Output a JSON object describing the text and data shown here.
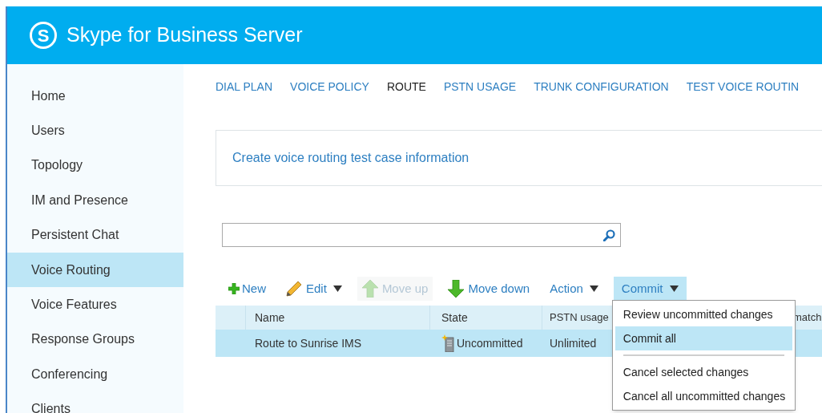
{
  "header": {
    "logo_glyph": "S",
    "title": "Skype for Business Server"
  },
  "sidebar": {
    "items": [
      {
        "label": "Home",
        "selected": false
      },
      {
        "label": "Users",
        "selected": false
      },
      {
        "label": "Topology",
        "selected": false
      },
      {
        "label": "IM and Presence",
        "selected": false
      },
      {
        "label": "Persistent Chat",
        "selected": false
      },
      {
        "label": "Voice Routing",
        "selected": true
      },
      {
        "label": "Voice Features",
        "selected": false
      },
      {
        "label": "Response Groups",
        "selected": false
      },
      {
        "label": "Conferencing",
        "selected": false
      },
      {
        "label": "Clients",
        "selected": false
      }
    ]
  },
  "tabs": [
    {
      "label": "DIAL PLAN",
      "selected": false
    },
    {
      "label": "VOICE POLICY",
      "selected": false
    },
    {
      "label": "ROUTE",
      "selected": true
    },
    {
      "label": "PSTN USAGE",
      "selected": false
    },
    {
      "label": "TRUNK CONFIGURATION",
      "selected": false
    },
    {
      "label": "TEST VOICE ROUTIN",
      "selected": false
    }
  ],
  "info_link": "Create voice routing test case information",
  "toolbar": [
    {
      "label": "New",
      "kind": "plus",
      "dropdown": false,
      "disabled": false,
      "expanded": false
    },
    {
      "label": "Edit",
      "kind": "pencil",
      "dropdown": true,
      "disabled": false,
      "expanded": false
    },
    {
      "label": "Move up",
      "kind": "up",
      "dropdown": false,
      "disabled": true,
      "expanded": false
    },
    {
      "label": "Move down",
      "kind": "down",
      "dropdown": false,
      "disabled": false,
      "expanded": false
    },
    {
      "label": "Action",
      "kind": "text",
      "dropdown": true,
      "disabled": false,
      "expanded": false
    },
    {
      "label": "Commit",
      "kind": "text",
      "dropdown": true,
      "disabled": false,
      "expanded": true
    }
  ],
  "commit_menu": [
    {
      "kind": "item",
      "label": "Review uncommitted changes",
      "selected": false
    },
    {
      "kind": "item",
      "label": "Commit all",
      "selected": true
    },
    {
      "kind": "separator"
    },
    {
      "kind": "item",
      "label": "Cancel selected changes",
      "selected": false
    },
    {
      "kind": "item",
      "label": "Cancel all uncommitted changes",
      "selected": false
    }
  ],
  "table": {
    "columns": {
      "name": "Name",
      "state": "State",
      "pstn_usage": "PSTN usage",
      "column_5": "match"
    },
    "rows": [
      {
        "name": "Route to Sunrise IMS",
        "state": "Uncommitted",
        "pstn_usage": "Unlimited",
        "selected": true
      }
    ]
  }
}
